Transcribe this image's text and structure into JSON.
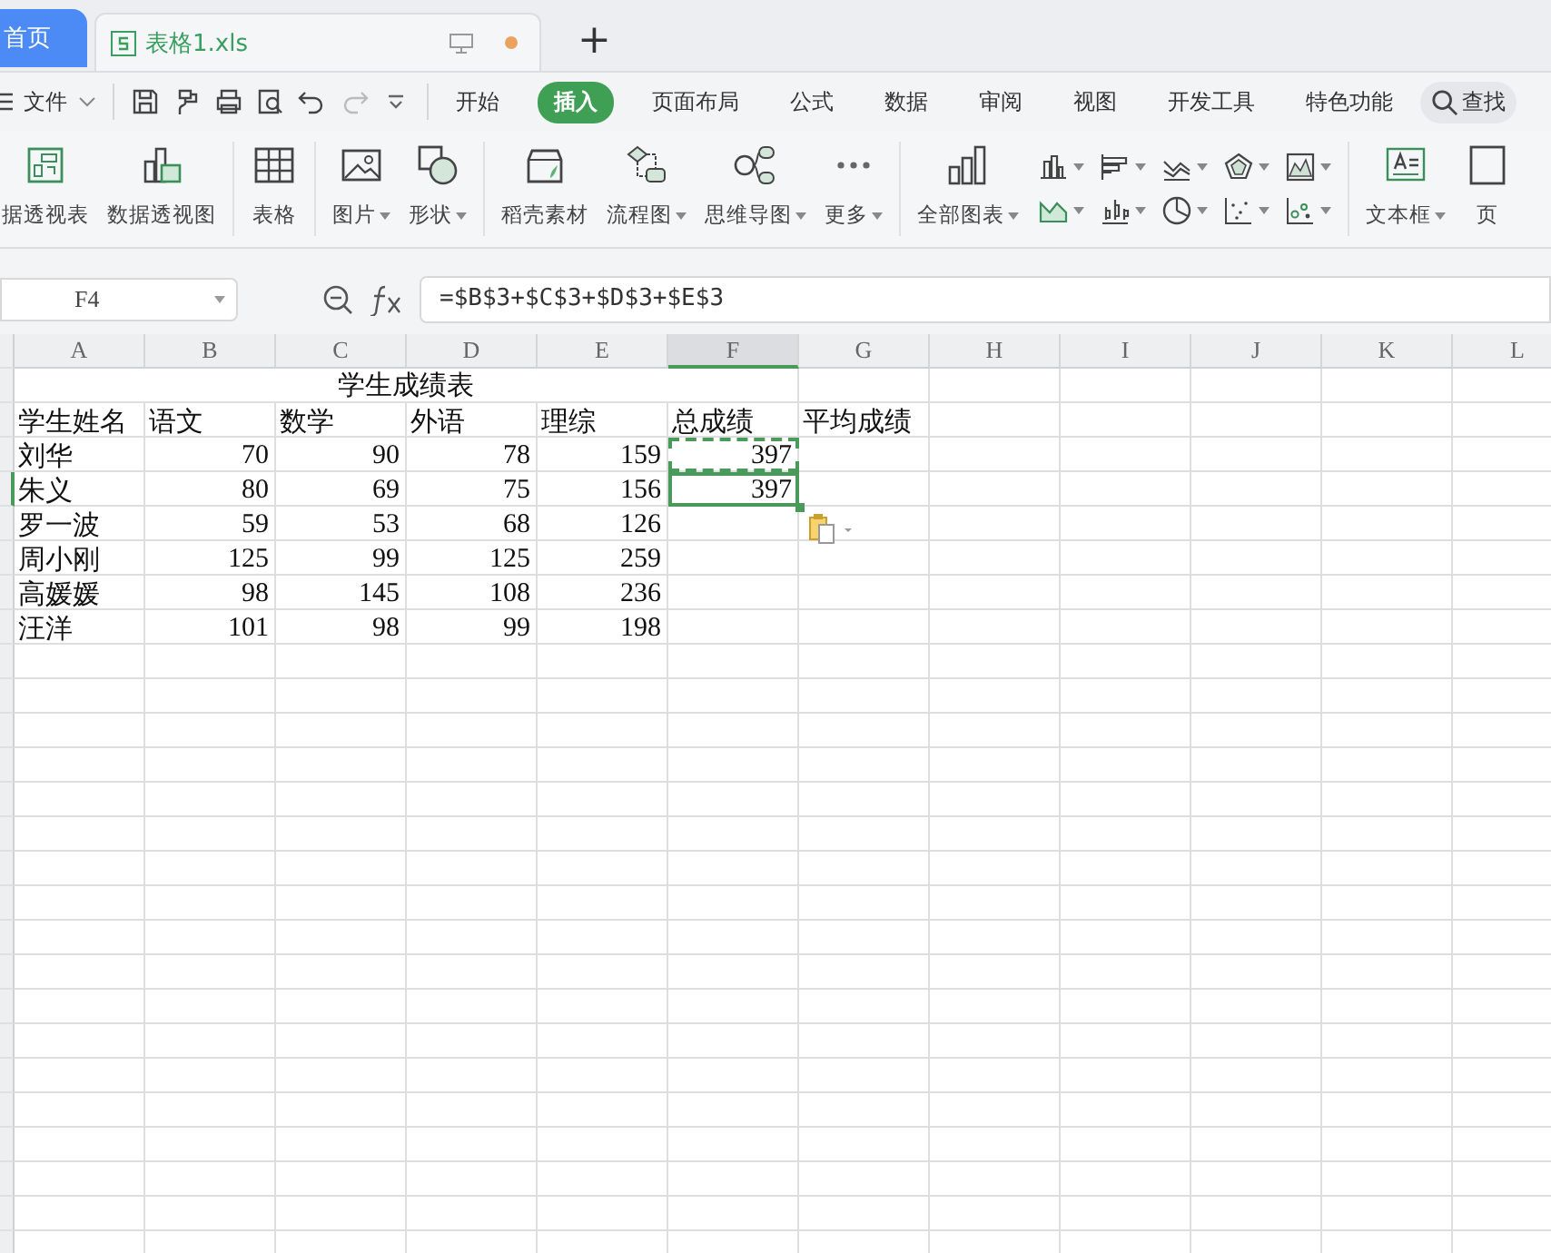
{
  "tabs": [
    {
      "label": "首页",
      "kind": "home",
      "selected": false
    },
    {
      "label": "表格1.xls",
      "kind": "document",
      "selected": true,
      "unsaved": true
    }
  ],
  "new_tab": "+",
  "file_menu": "文件",
  "ribbon_tabs": [
    {
      "label": "开始",
      "selected": false
    },
    {
      "label": "插入",
      "selected": true
    },
    {
      "label": "页面布局",
      "selected": false
    },
    {
      "label": "公式",
      "selected": false
    },
    {
      "label": "数据",
      "selected": false
    },
    {
      "label": "审阅",
      "selected": false
    },
    {
      "label": "视图",
      "selected": false
    },
    {
      "label": "开发工具",
      "selected": false
    },
    {
      "label": "特色功能",
      "selected": false
    }
  ],
  "search": "查找",
  "ribbon_groups": [
    {
      "items": [
        {
          "label": "据透视表",
          "dropdown": false
        },
        {
          "label": "数据透视图",
          "dropdown": false
        }
      ]
    },
    {
      "items": [
        {
          "label": "表格",
          "dropdown": false
        }
      ]
    },
    {
      "items": [
        {
          "label": "图片",
          "dropdown": true
        },
        {
          "label": "形状",
          "dropdown": true
        }
      ]
    },
    {
      "items": [
        {
          "label": "稻壳素材",
          "dropdown": false
        },
        {
          "label": "流程图",
          "dropdown": true
        },
        {
          "label": "思维导图",
          "dropdown": true
        },
        {
          "label": "更多",
          "dropdown": true
        }
      ]
    },
    {
      "items": [
        {
          "label": "全部图表",
          "dropdown": true
        }
      ],
      "chart_buttons": true
    },
    {
      "items": [
        {
          "label": "文本框",
          "dropdown": true
        },
        {
          "label": "页",
          "dropdown": false
        }
      ]
    }
  ],
  "name_box": "F4",
  "formula": "=$B$3+$C$3+$D$3+$E$3",
  "columns": [
    {
      "label": "A",
      "selected": false
    },
    {
      "label": "B",
      "selected": false
    },
    {
      "label": "C",
      "selected": false
    },
    {
      "label": "D",
      "selected": false
    },
    {
      "label": "E",
      "selected": false
    },
    {
      "label": "F",
      "selected": true
    },
    {
      "label": "G",
      "selected": false
    },
    {
      "label": "H",
      "selected": false
    },
    {
      "label": "I",
      "selected": false
    },
    {
      "label": "J",
      "selected": false
    },
    {
      "label": "K",
      "selected": false
    },
    {
      "label": "L",
      "selected": false
    }
  ],
  "sheet_title": "学生成绩表",
  "header_row": [
    "学生姓名",
    "语文",
    "数学",
    "外语",
    "理综",
    "总成绩",
    "平均成绩"
  ],
  "data_rows": [
    {
      "name": "刘华",
      "scores": [
        "70",
        "90",
        "78",
        "159"
      ],
      "total": "397",
      "copied": true,
      "selected": false
    },
    {
      "name": "朱义",
      "scores": [
        "80",
        "69",
        "75",
        "156"
      ],
      "total": "397",
      "copied": false,
      "selected": true
    },
    {
      "name": "罗一波",
      "scores": [
        "59",
        "53",
        "68",
        "126"
      ],
      "copied": false,
      "selected": false
    },
    {
      "name": "周小刚",
      "scores": [
        "125",
        "99",
        "125",
        "259"
      ],
      "copied": false,
      "selected": false
    },
    {
      "name": "高媛媛",
      "scores": [
        "98",
        "145",
        "108",
        "236"
      ],
      "copied": false,
      "selected": false
    },
    {
      "name": "汪洋",
      "scores": [
        "101",
        "98",
        "99",
        "198"
      ],
      "copied": false,
      "selected": false
    }
  ]
}
